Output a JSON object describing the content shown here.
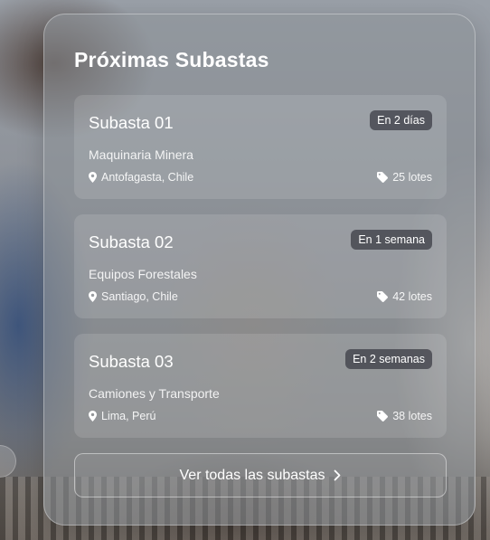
{
  "panel": {
    "title": "Próximas Subastas"
  },
  "auctions": [
    {
      "title": "Subasta 01",
      "badge": "En 2 días",
      "category": "Maquinaria Minera",
      "location": "Antofagasta, Chile",
      "lots": "25 lotes"
    },
    {
      "title": "Subasta 02",
      "badge": "En 1 semana",
      "category": "Equipos Forestales",
      "location": "Santiago, Chile",
      "lots": "42 lotes"
    },
    {
      "title": "Subasta 03",
      "badge": "En 2 semanas",
      "category": "Camiones y Transporte",
      "location": "Lima, Perú",
      "lots": "38 lotes"
    }
  ],
  "view_all": {
    "label": "Ver todas las subastas",
    "icon": "chevron-right-icon"
  },
  "icons": {
    "location": "map-pin-icon",
    "lots": "tag-icon"
  }
}
